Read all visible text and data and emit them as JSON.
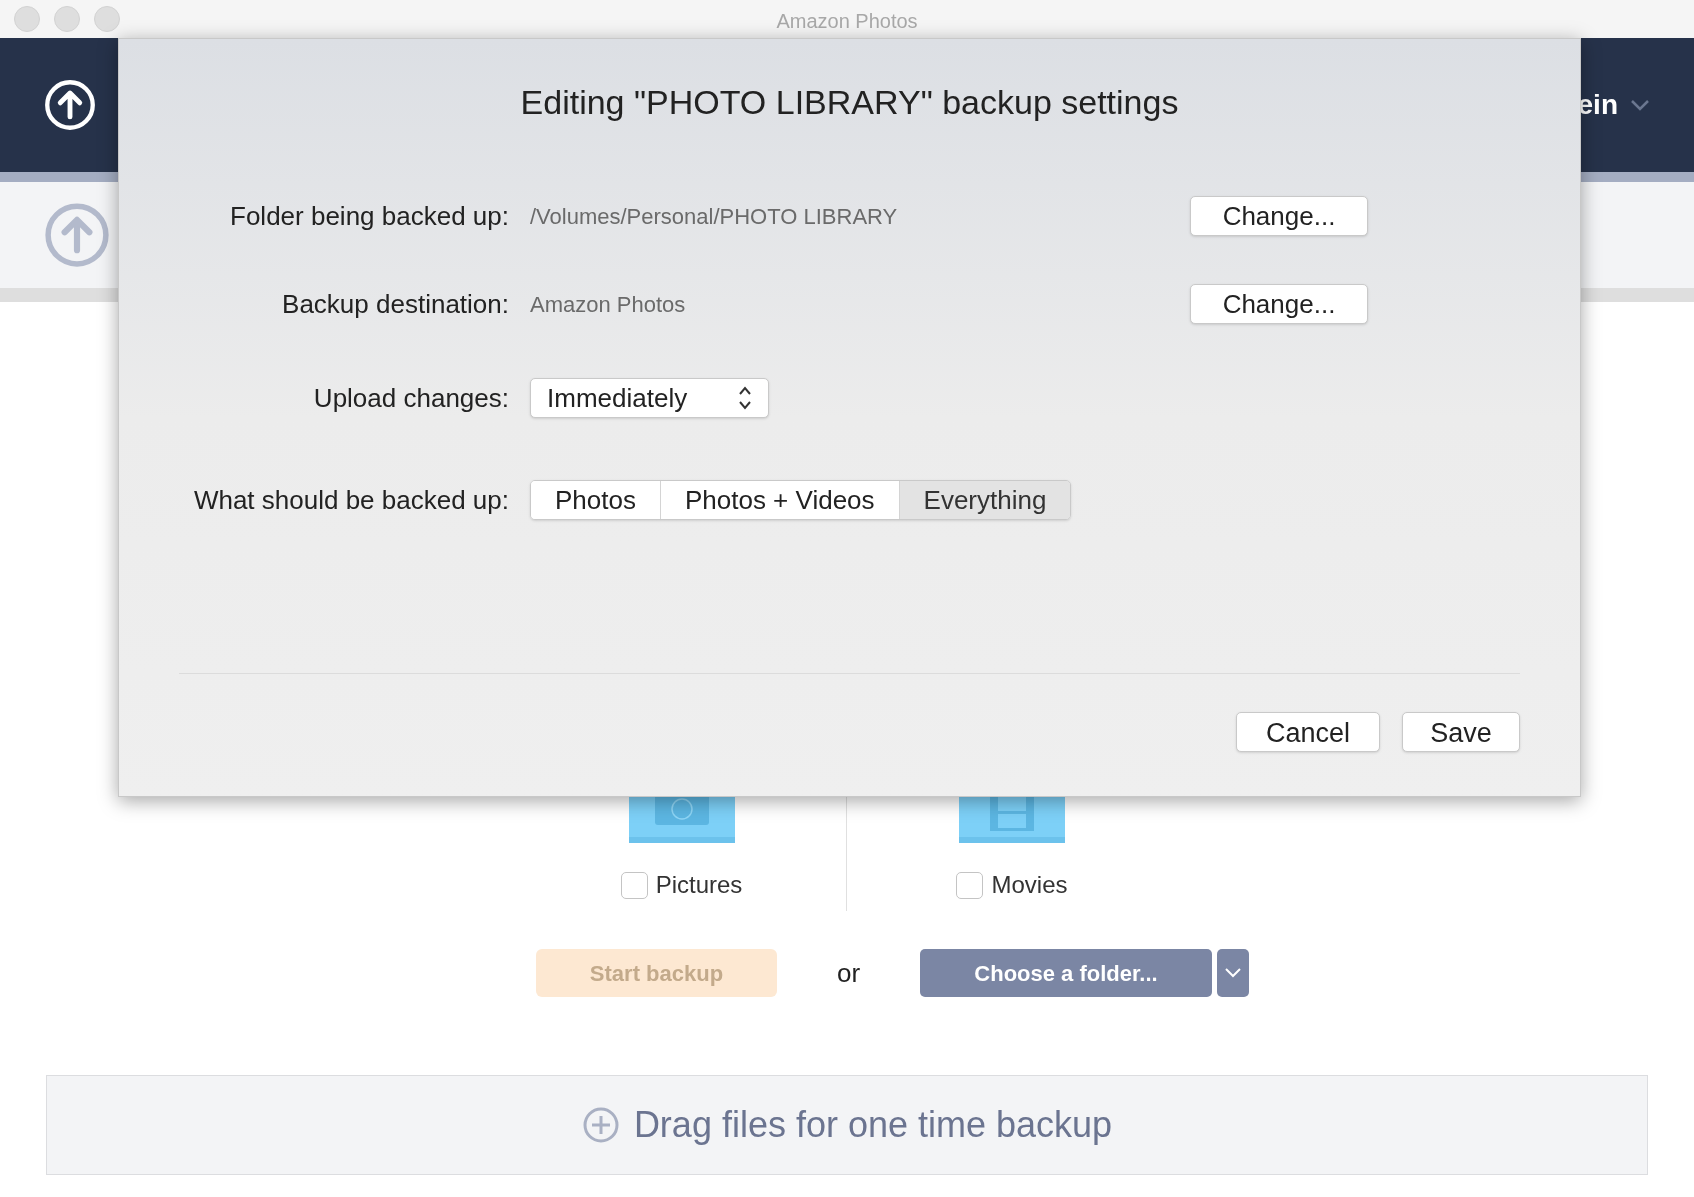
{
  "window": {
    "title": "Amazon Photos"
  },
  "header": {
    "account_label": "ein"
  },
  "folders": [
    {
      "label": "Pictures",
      "kind": "camera",
      "checked": false
    },
    {
      "label": "Movies",
      "kind": "film",
      "checked": false
    }
  ],
  "actions": {
    "start": "Start backup",
    "or": "or",
    "choose": "Choose a folder..."
  },
  "drop_zone": {
    "label": "Drag files for one time backup"
  },
  "dialog": {
    "title": "Editing \"PHOTO LIBRARY\" backup settings",
    "rows": [
      {
        "kind": "path",
        "label": "Folder being backed up:",
        "value": "/Volumes/Personal/PHOTO LIBRARY",
        "button": "Change..."
      },
      {
        "kind": "path",
        "label": "Backup destination:",
        "value": "Amazon Photos",
        "button": "Change..."
      },
      {
        "kind": "select",
        "label": "Upload changes:",
        "value": "Immediately"
      },
      {
        "kind": "segments",
        "label": "What should be backed up:",
        "options": [
          {
            "label": "Photos",
            "selected": false
          },
          {
            "label": "Photos + Videos",
            "selected": false
          },
          {
            "label": "Everything",
            "selected": true
          }
        ]
      }
    ],
    "buttons": [
      "Cancel",
      "Save"
    ]
  }
}
